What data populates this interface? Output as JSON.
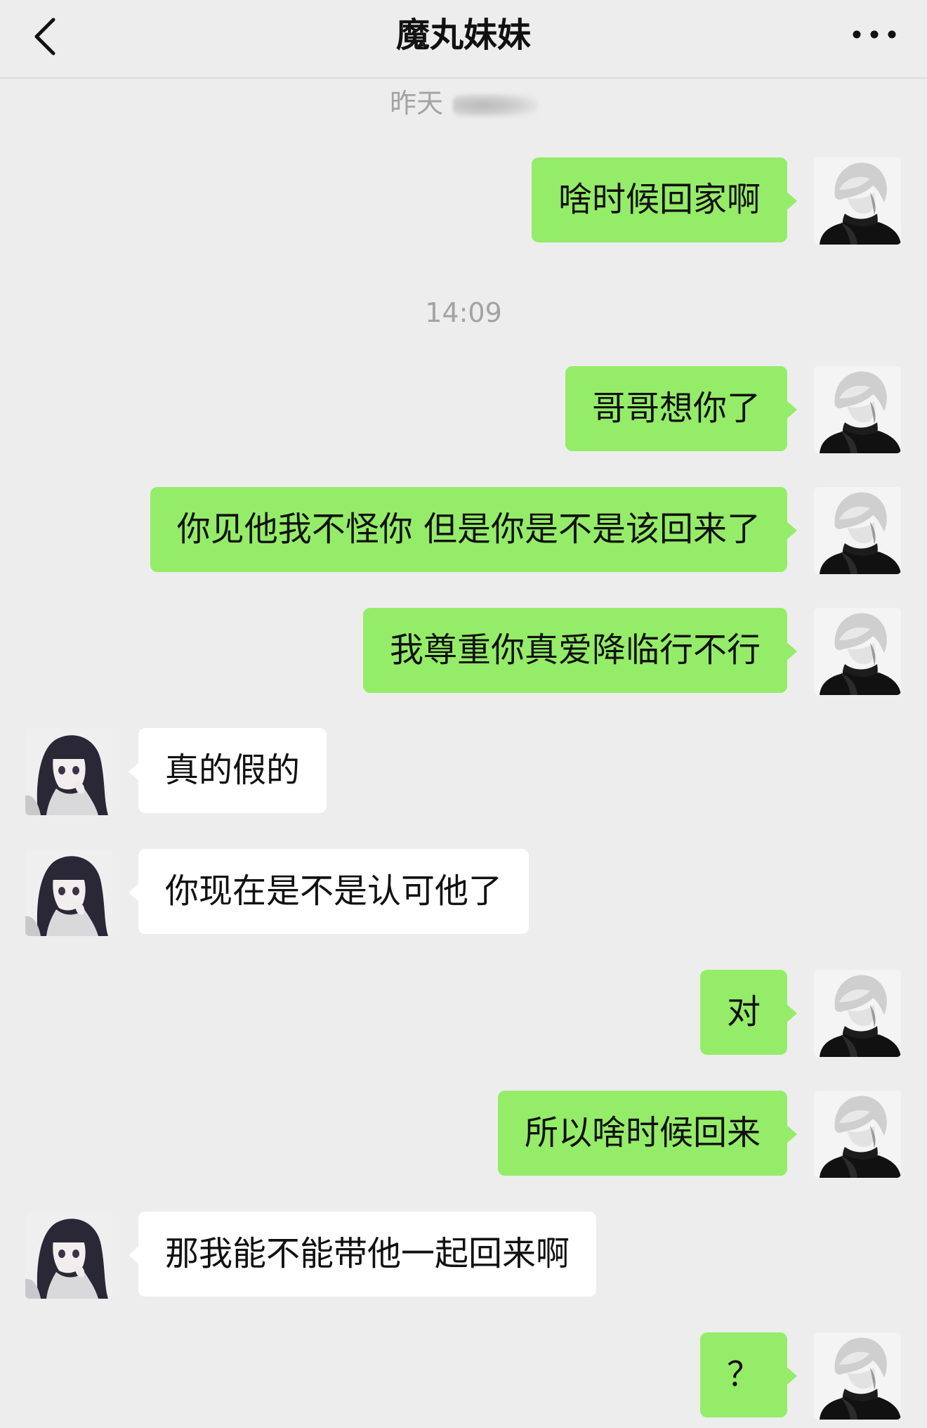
{
  "header": {
    "title": "魔丸妹妹",
    "back_icon": "chevron-left-icon",
    "more_icon": "more-dots-icon"
  },
  "timestamps": {
    "first": "昨天",
    "second": "14:09"
  },
  "messages": [
    {
      "side": "me",
      "text": "啥时候回家啊"
    },
    {
      "side": "me",
      "text": "哥哥想你了"
    },
    {
      "side": "me",
      "text": "你见他我不怪你 但是你是不是该回来了"
    },
    {
      "side": "me",
      "text": "我尊重你真爱降临行不行"
    },
    {
      "side": "her",
      "text": "真的假的"
    },
    {
      "side": "her",
      "text": "你现在是不是认可他了"
    },
    {
      "side": "me",
      "text": "对"
    },
    {
      "side": "me",
      "text": "所以啥时候回来"
    },
    {
      "side": "her",
      "text": "那我能不能带他一起回来啊"
    },
    {
      "side": "me",
      "text": "？"
    }
  ],
  "colors": {
    "background": "#ededed",
    "my_bubble": "#95ec69",
    "her_bubble": "#ffffff",
    "timestamp_text": "#a3a3a3"
  }
}
